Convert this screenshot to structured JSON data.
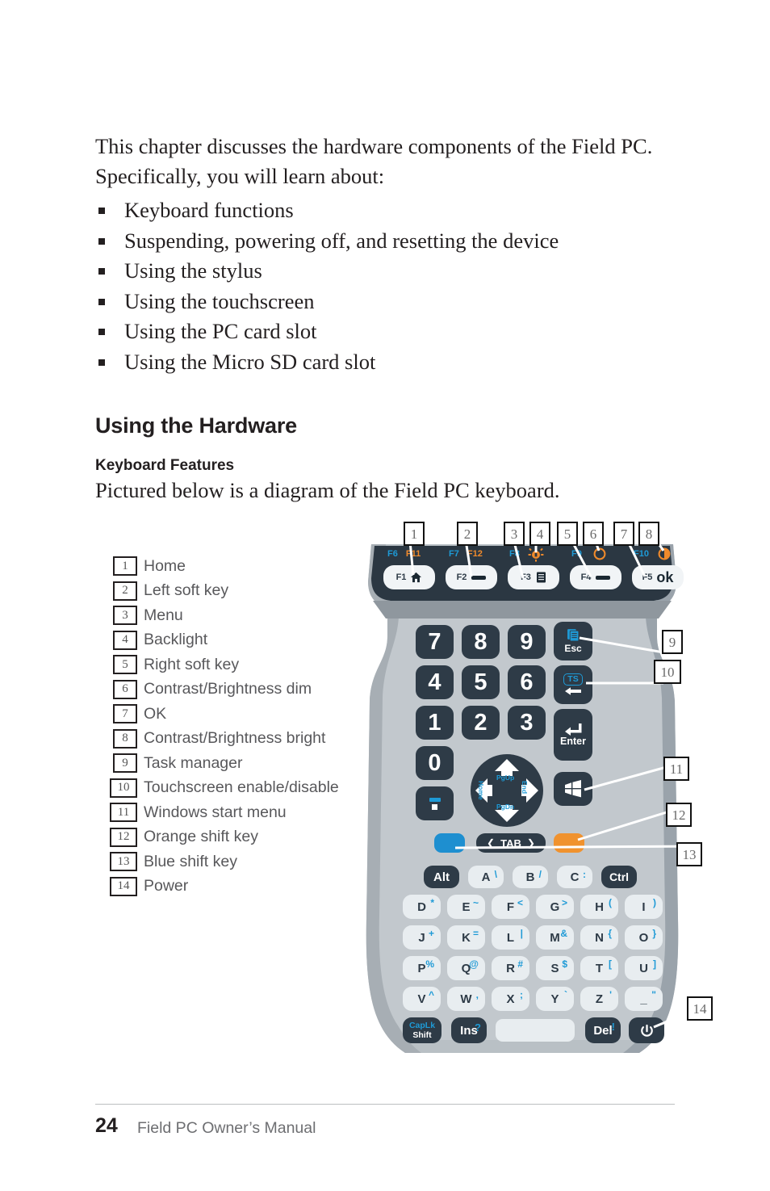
{
  "page": {
    "intro_paragraph": "This chapter discusses the hardware components of the Field PC. Specifically, you will learn about:",
    "bullets": [
      "Keyboard functions",
      "Suspending, powering off, and resetting the device",
      "Using the stylus",
      "Using the touchscreen",
      "Using the PC card slot",
      "Using the Micro SD card slot"
    ],
    "section_title": "Using the Hardware",
    "subsection_title": "Keyboard Features",
    "subsection_paragraph": "Pictured below is a diagram of the Field PC keyboard."
  },
  "legend": [
    {
      "num": "1",
      "label": "Home"
    },
    {
      "num": "2",
      "label": "Left soft key"
    },
    {
      "num": "3",
      "label": "Menu"
    },
    {
      "num": "4",
      "label": "Backlight"
    },
    {
      "num": "5",
      "label": "Right soft key"
    },
    {
      "num": "6",
      "label": "Contrast/Brightness dim"
    },
    {
      "num": "7",
      "label": "OK"
    },
    {
      "num": "8",
      "label": "Contrast/Brightness bright"
    },
    {
      "num": "9",
      "label": "Task manager"
    },
    {
      "num": "10",
      "label": "Touchscreen enable/disable"
    },
    {
      "num": "11",
      "label": "Windows start menu"
    },
    {
      "num": "12",
      "label": "Orange shift key"
    },
    {
      "num": "13",
      "label": "Blue shift key"
    },
    {
      "num": "14",
      "label": "Power"
    }
  ],
  "callouts": {
    "top": [
      "1",
      "2",
      "3",
      "4",
      "5",
      "6",
      "7",
      "8"
    ],
    "right": [
      "9",
      "10",
      "11",
      "12",
      "13",
      "14"
    ]
  },
  "keyboard": {
    "function_row": [
      {
        "key": "F1",
        "blue": "F6",
        "orange": "F11",
        "icon": "home-icon"
      },
      {
        "key": "F2",
        "blue": "F7",
        "orange": "F12",
        "icon": "left-soft-key-icon"
      },
      {
        "key": "F3",
        "blue": "F8",
        "orange": "",
        "icon": "menu-icon",
        "orange_icon": "backlight-icon"
      },
      {
        "key": "F4",
        "blue": "F9",
        "orange": "",
        "icon": "right-soft-key-icon",
        "orange_icon": "contrast-dim-icon"
      },
      {
        "key": "F5",
        "blue": "F10",
        "orange": "",
        "icon": "ok-icon",
        "label": "ok",
        "orange_icon": "contrast-bright-icon"
      }
    ],
    "numeric_keys": [
      "7",
      "8",
      "9",
      "4",
      "5",
      "6",
      "1",
      "2",
      "3",
      "0"
    ],
    "dash_key": "-",
    "dot_key": ".",
    "esc_key": "Esc",
    "ts_key": "TS",
    "enter_key": "Enter",
    "start_key": "windows-start-icon",
    "blue_shift_key": "blue-shift-key",
    "orange_shift_key": "orange-shift-key",
    "tab_key": "TAB",
    "alt_key": "Alt",
    "ctrl_key": "Ctrl",
    "dpad": {
      "up": "PgUp",
      "down": "PgDn",
      "left": "Home",
      "right": "End"
    },
    "alpha_rows": [
      [
        {
          "k": "A",
          "s": "\\"
        },
        {
          "k": "B",
          "s": "/"
        },
        {
          "k": "C",
          "s": ":"
        }
      ],
      [
        {
          "k": "D",
          "s": "*"
        },
        {
          "k": "E",
          "s": "~"
        },
        {
          "k": "F",
          "s": "<"
        },
        {
          "k": "G",
          "s": ">"
        },
        {
          "k": "H",
          "s": "("
        },
        {
          "k": "I",
          "s": ")"
        }
      ],
      [
        {
          "k": "J",
          "s": "+"
        },
        {
          "k": "K",
          "s": "="
        },
        {
          "k": "L",
          "s": "|"
        },
        {
          "k": "M",
          "s": "&"
        },
        {
          "k": "N",
          "s": "{"
        },
        {
          "k": "O",
          "s": "}"
        }
      ],
      [
        {
          "k": "P",
          "s": "%"
        },
        {
          "k": "Q",
          "s": "@"
        },
        {
          "k": "R",
          "s": "#"
        },
        {
          "k": "S",
          "s": "$"
        },
        {
          "k": "T",
          "s": "["
        },
        {
          "k": "U",
          "s": "]"
        }
      ],
      [
        {
          "k": "V",
          "s": "^"
        },
        {
          "k": "W",
          "s": ","
        },
        {
          "k": "X",
          "s": ";"
        },
        {
          "k": "Y",
          "s": "`"
        },
        {
          "k": "Z",
          "s": "'"
        },
        {
          "k": "_",
          "s": "\""
        }
      ]
    ],
    "bottom_row": {
      "caplk": "CapLk",
      "shift": "Shift",
      "ins": "Ins",
      "ins_sup": "?",
      "space": "",
      "del": "Del",
      "del_sup": "!",
      "power": "power-icon"
    }
  },
  "footer": {
    "page_number": "24",
    "manual_title": "Field PC Owner’s Manual"
  },
  "colors": {
    "blue_shift": "#1e8fd0",
    "orange_shift": "#f0922e",
    "key_dark": "#2e3b47",
    "key_light": "#e8edf0",
    "body_gray": "#9aa3ab",
    "body_gray_light": "#b6bcc2",
    "accent_blue": "#1e9ad6",
    "accent_orange": "#f08a2b"
  }
}
